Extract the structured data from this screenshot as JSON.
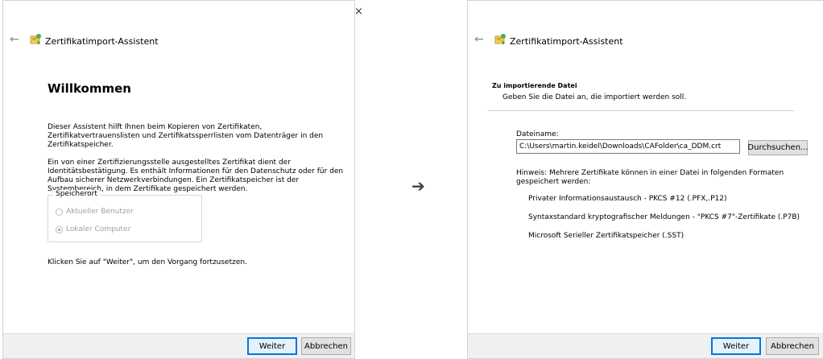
{
  "left_window": {
    "close_glyph": "×",
    "back_glyph": "←",
    "title": "Zertifikatimport-Assistent",
    "heading": "Willkommen",
    "intro": "Dieser Assistent hilft Ihnen beim Kopieren von Zertifikaten, Zertifikatvertrauenslisten und Zertifikatssperrlisten vom Datenträger in den Zertifikatspeicher.",
    "info": "Ein von einer Zertifizierungsstelle ausgestelltes Zertifikat dient der Identitätsbestätigung. Es enthält Informationen für den Datenschutz oder für den Aufbau sicherer Netzwerkverbindungen. Ein Zertifikatspeicher ist der Systembereich, in dem Zertifikate gespeichert werden.",
    "storage_group": {
      "legend": "Speicherort",
      "options": [
        {
          "label": "Aktueller Benutzer",
          "checked": false
        },
        {
          "label": "Lokaler Computer",
          "checked": true
        }
      ]
    },
    "continue_hint": "Klicken Sie auf \"Weiter\", um den Vorgang fortzusetzen.",
    "buttons": {
      "next": "Weiter",
      "cancel": "Abbrechen"
    }
  },
  "transition_arrow": "➔",
  "right_window": {
    "back_glyph": "←",
    "title": "Zertifikatimport-Assistent",
    "section_title": "Zu importierende Datei",
    "section_subtitle": "Geben Sie die Datei an, die importiert werden soll.",
    "filename_label": "Dateiname:",
    "filename_value": "C:\\Users\\martin.keidel\\Downloads\\CAFolder\\ca_DDM.crt",
    "browse_button": "Durchsuchen...",
    "hint": "Hinweis: Mehrere Zertifikate können in einer Datei in folgenden Formaten gespeichert werden:",
    "formats": [
      "Privater Informationsaustausch - PKCS #12 (.PFX,.P12)",
      "Syntaxstandard kryptografischer Meldungen - \"PKCS #7\"-Zertifikate (.P7B)",
      "Microsoft Serieller Zertifikatspeicher (.SST)"
    ],
    "buttons": {
      "next": "Weiter",
      "cancel": "Abbrechen"
    }
  },
  "colors": {
    "footer": "#f0f0f0",
    "primary_border": "#0078d7",
    "button_bg": "#e1e1e1"
  }
}
